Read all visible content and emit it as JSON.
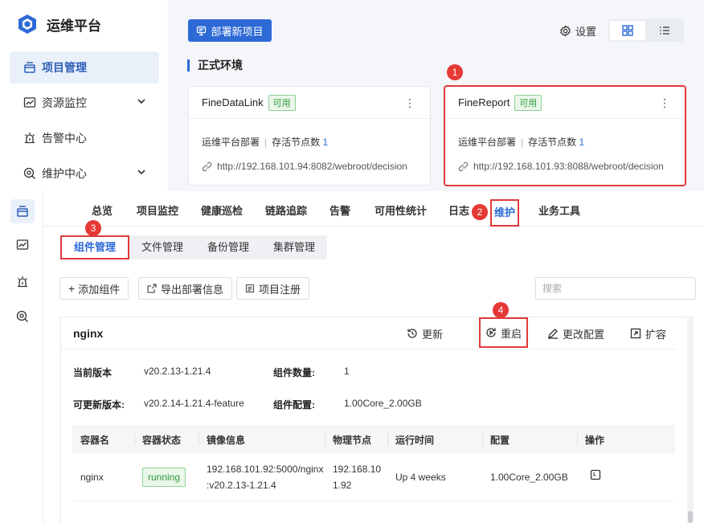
{
  "app": {
    "title": "运维平台"
  },
  "sidebar": {
    "items": [
      {
        "label": "项目管理",
        "icon": "project-icon",
        "active": true
      },
      {
        "label": "资源监控",
        "icon": "monitor-icon",
        "expandable": true
      },
      {
        "label": "告警中心",
        "icon": "alarm-icon"
      },
      {
        "label": "维护中心",
        "icon": "maintenance-icon",
        "expandable": true
      }
    ]
  },
  "toolbar": {
    "deploy_label": "部署新项目",
    "settings_label": "设置",
    "view_modes": [
      "grid-view-icon",
      "list-view-icon"
    ]
  },
  "environment": {
    "title": "正式环境",
    "cards": [
      {
        "name": "FineDataLink",
        "status": "可用",
        "deploy": "运维平台部署",
        "nodes_label": "存活节点数",
        "nodes": "1",
        "url": "http://192.168.101.94:8082/webroot/decision"
      },
      {
        "name": "FineReport",
        "status": "可用",
        "deploy": "运维平台部署",
        "nodes_label": "存活节点数",
        "nodes": "1",
        "url": "http://192.168.101.93:8088/webroot/decision"
      }
    ]
  },
  "annotations": [
    "1",
    "2",
    "3",
    "4"
  ],
  "tabs": [
    "总览",
    "项目监控",
    "健康巡检",
    "链路追踪",
    "告警",
    "可用性统计",
    "日志",
    "维护",
    "业务工具"
  ],
  "active_tab": "维护",
  "subtabs": [
    "组件管理",
    "文件管理",
    "备份管理",
    "集群管理"
  ],
  "active_subtab": "组件管理",
  "actions": {
    "add": "添加组件",
    "export": "导出部署信息",
    "register": "项目注册",
    "search_placeholder": "搜索"
  },
  "component": {
    "name": "nginx",
    "actions": [
      "更新",
      "重启",
      "更改配置",
      "扩容"
    ],
    "current_version_label": "当前版本",
    "current_version": "v20.2.13-1.21.4",
    "count_label": "组件数量:",
    "count": "1",
    "updatable_label": "可更新版本:",
    "updatable": "v20.2.14-1.21.4-feature",
    "config_label": "组件配置:",
    "config": "1.00Core_2.00GB",
    "table": {
      "headers": [
        "容器名",
        "容器状态",
        "镜像信息",
        "物理节点",
        "运行时间",
        "配置",
        "操作"
      ],
      "rows": [
        {
          "container": "nginx",
          "status": "running",
          "image_line1": "192.168.101.92:5000/nginx",
          "image_line2": ":v20.2.13-1.21.4",
          "node_line1": "192.168.10",
          "node_line2": "1.92",
          "uptime": "Up 4 weeks",
          "config": "1.00Core_2.00GB"
        }
      ]
    }
  },
  "colors": {
    "accent": "#2d6ad6",
    "highlight": "#e03a3a",
    "ok": "#2f9a3a"
  }
}
